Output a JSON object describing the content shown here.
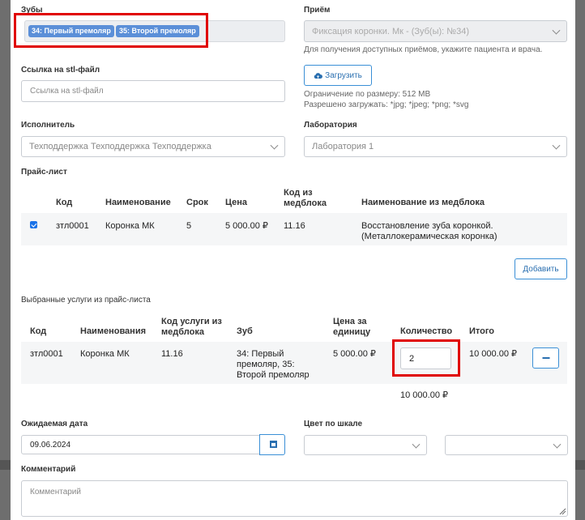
{
  "teeth": {
    "label": "Зубы",
    "tags": [
      "34: Первый премоляр",
      "35: Второй премоляр"
    ]
  },
  "appointment": {
    "label": "Приём",
    "value": "Фиксация коронки. Мк - (Зуб(ы): №34)",
    "hint": "Для получения доступных приёмов, укажите пациента и врача."
  },
  "stl": {
    "label": "Ссылка на stl-файл",
    "placeholder": "Ссылка на stl-файл"
  },
  "upload": {
    "button_label": "Загрузить",
    "limit_text": "Ограничение по размеру: 512 MB",
    "allowed_text": "Разрешено загружать: *jpg; *jpeg; *png; *svg"
  },
  "executor": {
    "label": "Исполнитель",
    "value": "Техподдержка Техподдержка Техподдержка"
  },
  "laboratory": {
    "label": "Лаборатория",
    "value": "Лаборатория 1"
  },
  "price_list": {
    "title": "Прайс-лист",
    "headers": {
      "code": "Код",
      "name": "Наименование",
      "term": "Срок",
      "price": "Цена",
      "med_code": "Код из медблока",
      "med_name": "Наименование из медблока"
    },
    "rows": [
      {
        "checked": true,
        "code": "зтл0001",
        "name": "Коронка МК",
        "term": "5",
        "price": "5 000.00 ₽",
        "med_code": "11.16",
        "med_name": "Восстановление зуба коронкой. (Металлокерамическая коронка)"
      }
    ],
    "add_button": "Добавить"
  },
  "selected": {
    "title": "Выбранные услуги из прайс-листа",
    "headers": {
      "code": "Код",
      "name": "Наименования",
      "med_code": "Код услуги из медблока",
      "tooth": "Зуб",
      "unit_price": "Цена за единицу",
      "qty": "Количество",
      "total": "Итого"
    },
    "rows": [
      {
        "code": "зтл0001",
        "name": "Коронка МК",
        "med_code": "11.16",
        "tooth": "34: Первый премоляр, 35: Второй премоляр",
        "unit_price": "5 000.00 ₽",
        "qty": "2",
        "total": "10 000.00 ₽"
      }
    ],
    "sum": "10 000.00 ₽"
  },
  "expected_date": {
    "label": "Ожидаемая дата",
    "value": "09.06.2024"
  },
  "color_scale": {
    "label": "Цвет по шкале"
  },
  "comment": {
    "label": "Комментарий",
    "placeholder": "Комментарий"
  }
}
